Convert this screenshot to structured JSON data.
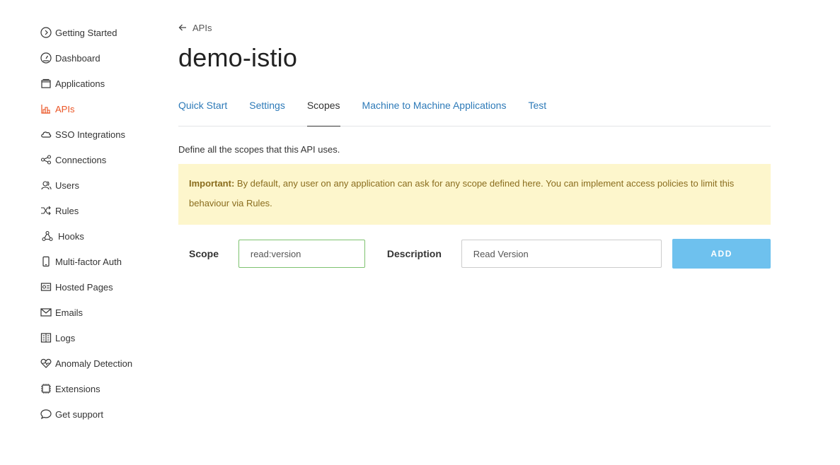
{
  "sidebar": {
    "items": [
      {
        "label": "Getting Started",
        "icon": "play-circle-icon"
      },
      {
        "label": "Dashboard",
        "icon": "gauge-icon"
      },
      {
        "label": "Applications",
        "icon": "window-stack-icon"
      },
      {
        "label": "APIs",
        "icon": "api-blocks-icon",
        "active": true
      },
      {
        "label": "SSO Integrations",
        "icon": "cloud-icon"
      },
      {
        "label": "Connections",
        "icon": "connections-icon"
      },
      {
        "label": "Users",
        "icon": "users-icon"
      },
      {
        "label": "Rules",
        "icon": "shuffle-icon"
      },
      {
        "label": "Hooks",
        "icon": "hooks-icon"
      },
      {
        "label": "Multi-factor Auth",
        "icon": "phone-icon"
      },
      {
        "label": "Hosted Pages",
        "icon": "hosted-pages-icon"
      },
      {
        "label": "Emails",
        "icon": "envelope-icon"
      },
      {
        "label": "Logs",
        "icon": "book-icon"
      },
      {
        "label": "Anomaly Detection",
        "icon": "heart-pulse-icon"
      },
      {
        "label": "Extensions",
        "icon": "chip-icon"
      },
      {
        "label": "Get support",
        "icon": "chat-bubble-icon"
      }
    ],
    "active_color": "#eb5424"
  },
  "breadcrumb": {
    "label": "APIs"
  },
  "page": {
    "title": "demo-istio"
  },
  "tabs": [
    {
      "label": "Quick Start"
    },
    {
      "label": "Settings"
    },
    {
      "label": "Scopes",
      "active": true
    },
    {
      "label": "Machine to Machine Applications"
    },
    {
      "label": "Test"
    }
  ],
  "scopes": {
    "description": "Define all the scopes that this API uses.",
    "warning": {
      "prefix": "Important:",
      "text": " By default, any user on any application can ask for any scope defined here. You can implement access policies to limit this behaviour via Rules."
    },
    "form": {
      "scope_label": "Scope",
      "scope_value": "read:version",
      "description_label": "Description",
      "description_value": "Read Version",
      "add_label": "ADD"
    }
  },
  "colors": {
    "link": "#2d7ab8",
    "warning_bg": "#fdf6cc",
    "add_button": "#6ec1ee"
  }
}
